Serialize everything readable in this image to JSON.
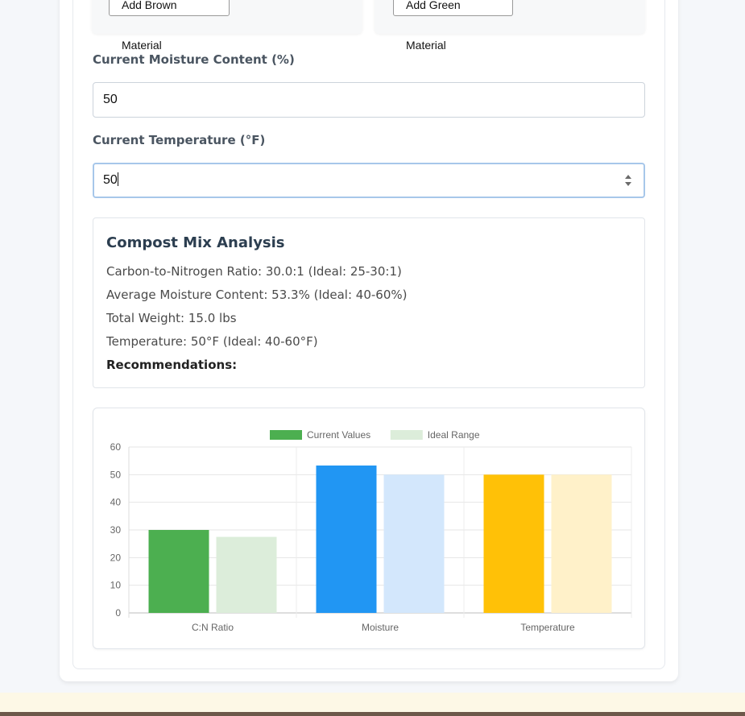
{
  "materials": {
    "brown_button": "Add Brown Material",
    "green_button": "Add Green Material"
  },
  "moisture": {
    "label": "Current Moisture Content (%)",
    "value": "50"
  },
  "temperature": {
    "label": "Current Temperature (°F)",
    "value": "50"
  },
  "analysis": {
    "title": "Compost Mix Analysis",
    "cn_ratio": "Carbon-to-Nitrogen Ratio: 30.0:1 (Ideal: 25-30:1)",
    "avg_moisture": "Average Moisture Content: 53.3% (Ideal: 40-60%)",
    "total_weight": "Total Weight: 15.0 lbs",
    "temperature": "Temperature: 50°F (Ideal: 40-60°F)",
    "recommendations": "Recommendations:"
  },
  "chart_data": {
    "type": "bar",
    "categories": [
      "C:N Ratio",
      "Moisture",
      "Temperature"
    ],
    "series": [
      {
        "name": "Current Values",
        "values": [
          30,
          53.3,
          50
        ],
        "colors": [
          "#4caf50",
          "#2196f3",
          "#ffc107"
        ]
      },
      {
        "name": "Ideal Range",
        "values": [
          27.5,
          50,
          50
        ],
        "colors": [
          "#dcedda",
          "#d3e7fc",
          "#fff1c9"
        ]
      }
    ],
    "legend": {
      "placement": "top",
      "colors": [
        "#4caf50",
        "#dcedda"
      ]
    },
    "ylim": [
      0,
      60
    ],
    "yticks": [
      0,
      10,
      20,
      30,
      40,
      50,
      60
    ],
    "grid": true
  }
}
